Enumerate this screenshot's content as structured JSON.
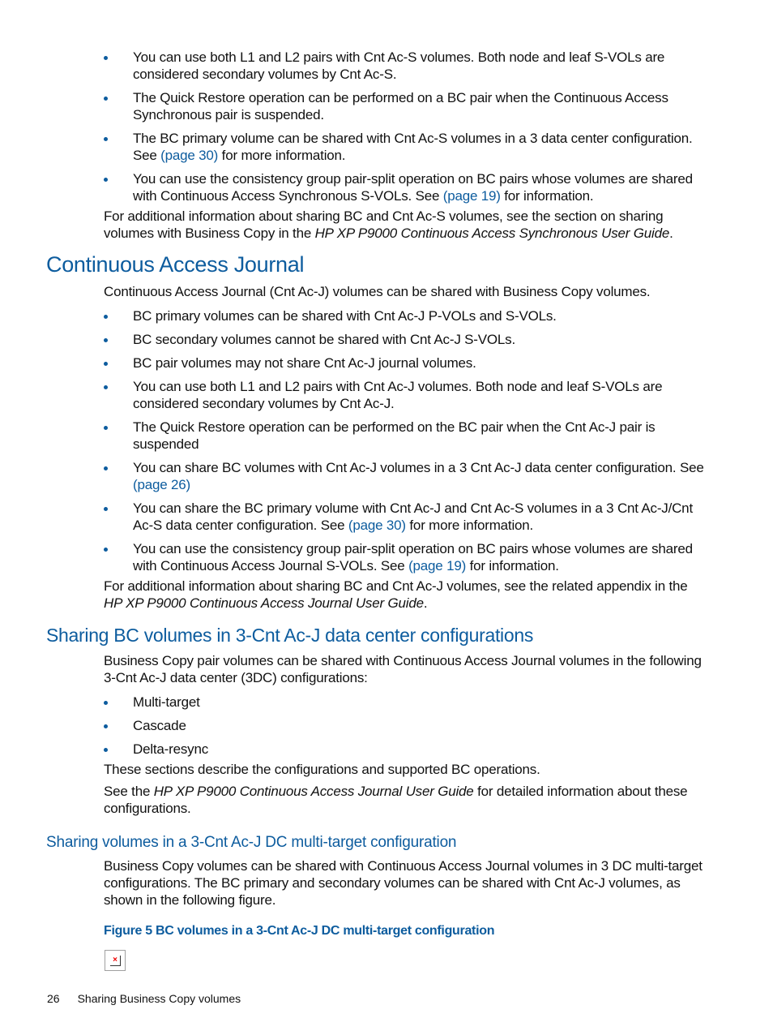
{
  "top_section": {
    "bullets": [
      {
        "text": "You can use both L1 and L2 pairs with Cnt Ac-S volumes. Both node and leaf S-VOLs are considered secondary volumes by Cnt Ac-S."
      },
      {
        "text": "The Quick Restore operation can be performed on a BC pair when the Continuous Access Synchronous pair is suspended."
      },
      {
        "pre": "The BC primary volume can be shared with Cnt Ac-S volumes in a 3 data center configuration. See ",
        "link": "(page 30)",
        "post": " for more information."
      },
      {
        "pre": "You can use the consistency group pair-split operation on BC pairs whose volumes are shared with Continuous Access Synchronous S-VOLs. See ",
        "link": "(page 19)",
        "post": " for information."
      }
    ],
    "note_pre": "For additional information about sharing BC and Cnt Ac-S volumes, see the section on sharing volumes with Business Copy in the ",
    "note_italic": "HP XP P9000 Continuous Access Synchronous User Guide",
    "note_post": "."
  },
  "caj_section": {
    "heading": "Continuous Access Journal",
    "intro": "Continuous Access Journal (Cnt Ac-J) volumes can be shared with Business Copy volumes.",
    "bullets": [
      {
        "text": "BC primary volumes can be shared with Cnt Ac-J P-VOLs and S-VOLs."
      },
      {
        "text": "BC secondary volumes cannot be shared with Cnt Ac-J S-VOLs."
      },
      {
        "text": "BC pair volumes may not share Cnt Ac-J journal volumes."
      },
      {
        "text": "You can use both L1 and L2 pairs with Cnt Ac-J volumes. Both node and leaf S-VOLs are considered secondary volumes by Cnt Ac-J."
      },
      {
        "text": "The Quick Restore operation can be performed on the BC pair when the Cnt Ac-J pair is suspended"
      },
      {
        "pre": "You can share BC volumes with Cnt Ac-J volumes in a 3 Cnt Ac-J data center configuration. See ",
        "link": "(page 26)",
        "post": ""
      },
      {
        "pre": "You can share the BC primary volume with Cnt Ac-J and Cnt Ac-S volumes in a 3 Cnt Ac-J/Cnt Ac-S data center configuration. See ",
        "link": "(page 30)",
        "post": " for more information."
      },
      {
        "pre": "You can use the consistency group pair-split operation on BC pairs whose volumes are shared with Continuous Access Journal S-VOLs. See ",
        "link": "(page 19)",
        "post": " for information."
      }
    ],
    "note_pre": "For additional information about sharing BC and Cnt Ac-J volumes, see the related appendix in the ",
    "note_italic": "HP XP P9000 Continuous Access Journal User Guide",
    "note_post": "."
  },
  "threedc_section": {
    "heading": "Sharing BC volumes in 3-Cnt Ac-J data center configurations",
    "intro": "Business Copy pair volumes can be shared with Continuous Access Journal volumes in the following 3-Cnt Ac-J data center (3DC) configurations:",
    "bullets": [
      "Multi-target",
      "Cascade",
      "Delta-resync"
    ],
    "para1": "These sections describe the configurations and supported BC operations.",
    "para2_pre": "See the ",
    "para2_italic": "HP XP P9000 Continuous Access Journal User Guide",
    "para2_post": " for detailed information about these configurations."
  },
  "multitarget_section": {
    "heading": "Sharing volumes in a 3-Cnt Ac-J DC multi-target configuration",
    "para": "Business Copy volumes can be shared with Continuous Access Journal volumes in 3 DC multi-target configurations. The BC primary and secondary volumes can be shared with Cnt Ac-J volumes, as shown in the following figure.",
    "figure_caption": "Figure 5 BC volumes in a 3-Cnt Ac-J DC multi-target configuration",
    "figure_icon": "broken-image-icon"
  },
  "footer": {
    "page_number": "26",
    "section_title": "Sharing Business Copy volumes"
  },
  "colors": {
    "accent": "#0d5c9e",
    "text": "#111111"
  }
}
